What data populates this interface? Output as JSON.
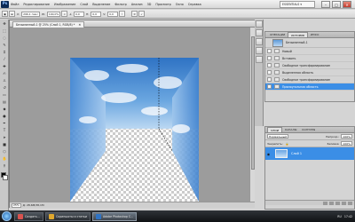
{
  "app": {
    "logo": "Ps"
  },
  "menu": [
    "Файл",
    "Редактирование",
    "Изображение",
    "Слой",
    "Выделение",
    "Фильтр",
    "Анализ",
    "3D",
    "Просмотр",
    "Окно",
    "Справка"
  ],
  "workspace": "ESSENTIALS ▾",
  "window_controls": {
    "minimize": "–",
    "maximize": "□",
    "close": "✕"
  },
  "options_bar": {
    "fields": [
      "296,1 пикс",
      "100,0%",
      "0,0",
      "0,0",
      "0,0",
      "0,0"
    ],
    "labels": [
      "X:",
      "Y:",
      "W:",
      "H:",
      "∠",
      "H:",
      "V:"
    ]
  },
  "document": {
    "tab_title": "Безымянный-1 @ 25% (Слой 1, RGB/8) *",
    "close": "✕",
    "status": {
      "zoom": "25%",
      "info": "Д: 28,6M/38,1M"
    }
  },
  "history_panel": {
    "tabs": [
      "ОПЕРАЦИИ",
      "ИСТОРИЯ",
      "ИНФО"
    ],
    "active_tab": 1,
    "snapshot": "Безымянный-1",
    "items": [
      "Новый",
      "Вставить",
      "Свободное трансформирование",
      "Выделенная область",
      "Свободное трансформирование",
      "Прямоугольная область"
    ],
    "selected_item": 5
  },
  "layers_panel": {
    "tabs": [
      "СЛОИ",
      "КАНАЛЫ",
      "КОНТУРЫ"
    ],
    "active_tab": 0,
    "blend_mode": "Нормальный",
    "opacity_label": "Непрозр.:",
    "opacity": "100%",
    "lock_label": "Закрепить:",
    "fill_label": "Заливка:",
    "fill": "100%",
    "layer_name": "Слой 1"
  },
  "taskbar": {
    "buttons": [
      "Создать…",
      "Скриншоты и статьи",
      "Adobe Photoshop C…"
    ],
    "active_button": 2,
    "lang": "RU",
    "time": "17:42"
  },
  "colors": {
    "selection": "#3b8ee6",
    "sky_top": "#2f73c4",
    "sky_bottom": "#bcd8f2"
  }
}
